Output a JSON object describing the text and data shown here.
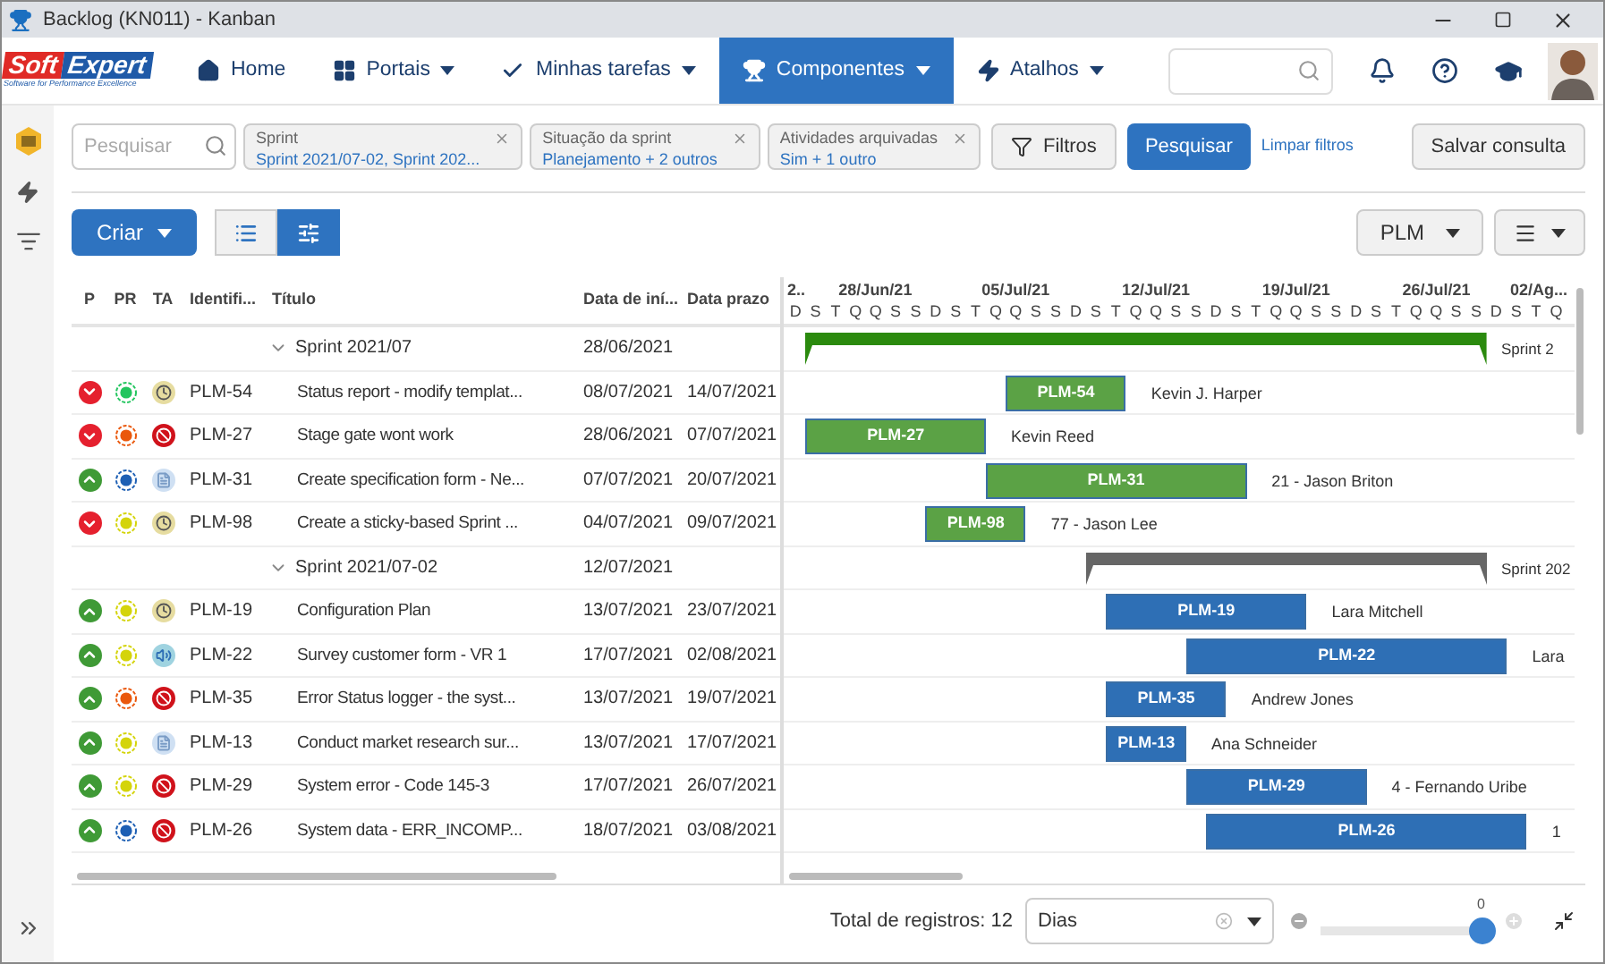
{
  "window": {
    "title": "Backlog (KN011) - Kanban"
  },
  "logo": {
    "left": "Soft",
    "right": "Expert",
    "tagline": "Software for Performance Excellence"
  },
  "nav": [
    {
      "label": "Home",
      "dropdown": false,
      "selected": false
    },
    {
      "label": "Portais",
      "dropdown": true,
      "selected": false
    },
    {
      "label": "Minhas tarefas",
      "dropdown": true,
      "selected": false
    },
    {
      "label": "Componentes",
      "dropdown": true,
      "selected": true
    },
    {
      "label": "Atalhos",
      "dropdown": true,
      "selected": false
    }
  ],
  "filters": {
    "search_placeholder": "Pesquisar",
    "chips": [
      {
        "label": "Sprint",
        "value": "Sprint 2021/07-02, Sprint 202..."
      },
      {
        "label": "Situação da sprint",
        "value": "Planejamento + 2 outros"
      },
      {
        "label": "Atividades arquivadas",
        "value": "Sim + 1 outro"
      }
    ],
    "filter_button": "Filtros",
    "search_button": "Pesquisar",
    "clear_link": "Limpar filtros",
    "save_button": "Salvar consulta"
  },
  "toolbar": {
    "create_button": "Criar",
    "views": [
      {
        "kind": "list",
        "selected": false
      },
      {
        "kind": "gantt",
        "selected": true
      }
    ],
    "project_button": "PLM"
  },
  "table": {
    "columns": [
      "P",
      "PR",
      "TA",
      "Identifi...",
      "Título",
      "Data de iní...",
      "Data prazo"
    ],
    "groups": [
      {
        "title": "Sprint 2021/07",
        "start": "28/06/2021",
        "expanded": true,
        "color": "#2b8a0e",
        "gantt_label": "Sprint 2",
        "rows": [
          {
            "priority_up": false,
            "status": {
              "color": "#22c55e"
            },
            "type": {
              "kind": "clock"
            },
            "id": "PLM-54",
            "title": "Status report - modify templat...",
            "start": "08/07/2021",
            "due": "14/07/2021",
            "color": "#5ba245",
            "bar_label": "PLM-54",
            "assignee": "Kevin J. Harper"
          },
          {
            "priority_up": false,
            "status": {
              "color": "#ea580c"
            },
            "type": {
              "kind": "blocked"
            },
            "id": "PLM-27",
            "title": "Stage gate wont work",
            "start": "28/06/2021",
            "due": "07/07/2021",
            "color": "#5ba245",
            "bar_label": "PLM-27",
            "assignee": "Kevin Reed"
          },
          {
            "priority_up": true,
            "status": {
              "color": "#1d5fb4"
            },
            "type": {
              "kind": "document"
            },
            "id": "PLM-31",
            "title": "Create specification form - Ne...",
            "start": "07/07/2021",
            "due": "20/07/2021",
            "color": "#5ba245",
            "bar_label": "PLM-31",
            "assignee": "21 - Jason Briton"
          },
          {
            "priority_up": false,
            "status": {
              "color": "#d4d40a"
            },
            "type": {
              "kind": "clock"
            },
            "id": "PLM-98",
            "title": "Create a sticky-based Sprint ...",
            "start": "04/07/2021",
            "due": "09/07/2021",
            "color": "#5ba245",
            "bar_label": "PLM-98",
            "assignee": "77 - Jason Lee"
          }
        ]
      },
      {
        "title": "Sprint 2021/07-02",
        "start": "12/07/2021",
        "expanded": true,
        "color": "#666666",
        "gantt_label": "Sprint 202",
        "rows": [
          {
            "priority_up": true,
            "status": {
              "color": "#d4d40a"
            },
            "type": {
              "kind": "clock"
            },
            "id": "PLM-19",
            "title": "Configuration Plan",
            "start": "13/07/2021",
            "due": "23/07/2021",
            "color": "#2e6fb5",
            "bar_label": "PLM-19",
            "assignee": "Lara Mitchell"
          },
          {
            "priority_up": true,
            "status": {
              "color": "#d4d40a"
            },
            "type": {
              "kind": "speaker"
            },
            "id": "PLM-22",
            "title": "Survey customer form - VR 1",
            "start": "17/07/2021",
            "due": "02/08/2021",
            "color": "#2e6fb5",
            "bar_label": "PLM-22",
            "assignee": "Lara"
          },
          {
            "priority_up": true,
            "status": {
              "color": "#ea580c"
            },
            "type": {
              "kind": "blocked"
            },
            "id": "PLM-35",
            "title": "Error Status logger - the syst...",
            "start": "13/07/2021",
            "due": "19/07/2021",
            "color": "#2e6fb5",
            "bar_label": "PLM-35",
            "assignee": "Andrew Jones"
          },
          {
            "priority_up": true,
            "status": {
              "color": "#d4d40a"
            },
            "type": {
              "kind": "document"
            },
            "id": "PLM-13",
            "title": "Conduct market research sur...",
            "start": "13/07/2021",
            "due": "17/07/2021",
            "color": "#2e6fb5",
            "bar_label": "PLM-13",
            "assignee": "Ana Schneider"
          },
          {
            "priority_up": true,
            "status": {
              "color": "#d4d40a"
            },
            "type": {
              "kind": "blocked"
            },
            "id": "PLM-29",
            "title": "System error - Code 145-3",
            "start": "17/07/2021",
            "due": "26/07/2021",
            "color": "#2e6fb5",
            "bar_label": "PLM-29",
            "assignee": "4 - Fernando Uribe"
          },
          {
            "priority_up": true,
            "status": {
              "color": "#1d5fb4"
            },
            "type": {
              "kind": "blocked"
            },
            "id": "PLM-26",
            "title": "System data - ERR_INCOMP...",
            "start": "18/07/2021",
            "due": "03/08/2021",
            "color": "#2e6fb5",
            "bar_label": "PLM-26",
            "assignee": "1"
          }
        ]
      }
    ]
  },
  "gantt": {
    "weeks": [
      "2..",
      "28/Jun/21",
      "05/Jul/21",
      "12/Jul/21",
      "19/Jul/21",
      "26/Jul/21",
      "02/Ag..."
    ],
    "days": [
      "D",
      "S",
      "T",
      "Q",
      "Q",
      "S",
      "S",
      "D",
      "S",
      "T",
      "Q",
      "Q",
      "S",
      "S",
      "D",
      "S",
      "T",
      "Q",
      "Q",
      "S",
      "S",
      "D",
      "S",
      "T",
      "Q",
      "Q",
      "S",
      "S",
      "D",
      "S",
      "T",
      "Q",
      "Q",
      "S",
      "S",
      "D",
      "S",
      "T",
      "Q"
    ]
  },
  "footer": {
    "total": "Total de registros: 12",
    "scale": "Dias",
    "zoom": {
      "reading": "0",
      "level": 1
    }
  }
}
